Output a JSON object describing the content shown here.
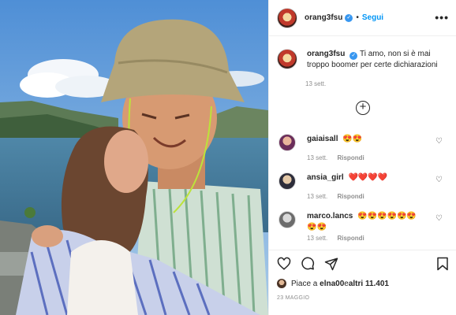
{
  "post": {
    "author": "orang3fsu",
    "follow_label": "Segui",
    "more_label": "•••",
    "caption_text": "Ti amo, non si è mai troppo boomer per certe dichiarazioni",
    "caption_time": "13 sett.",
    "load_more_label": "+"
  },
  "comments": [
    {
      "user": "gaiaisall",
      "text": "😍😍",
      "time": "13 sett.",
      "reply": "Rispondi"
    },
    {
      "user": "ansia_girl",
      "text": "❤️❤️❤️❤️",
      "time": "13 sett.",
      "reply": "Rispondi"
    },
    {
      "user": "marco.lancs",
      "text": "😍😍😍😍😍😍😍😍",
      "time": "13 sett.",
      "reply": "Rispondi"
    }
  ],
  "likes": {
    "prefix": "Piace a ",
    "first_user": "elna00",
    "middle": " e ",
    "others": "altri 11.401"
  },
  "post_date": "23 MAGGIO",
  "icons": [
    "heart-icon",
    "comment-icon",
    "share-icon",
    "bookmark-icon",
    "verified-icon",
    "plus-circle-icon"
  ],
  "colors": {
    "accent": "#0095f6",
    "verified": "#3897f0",
    "muted": "#8e8e8e"
  }
}
